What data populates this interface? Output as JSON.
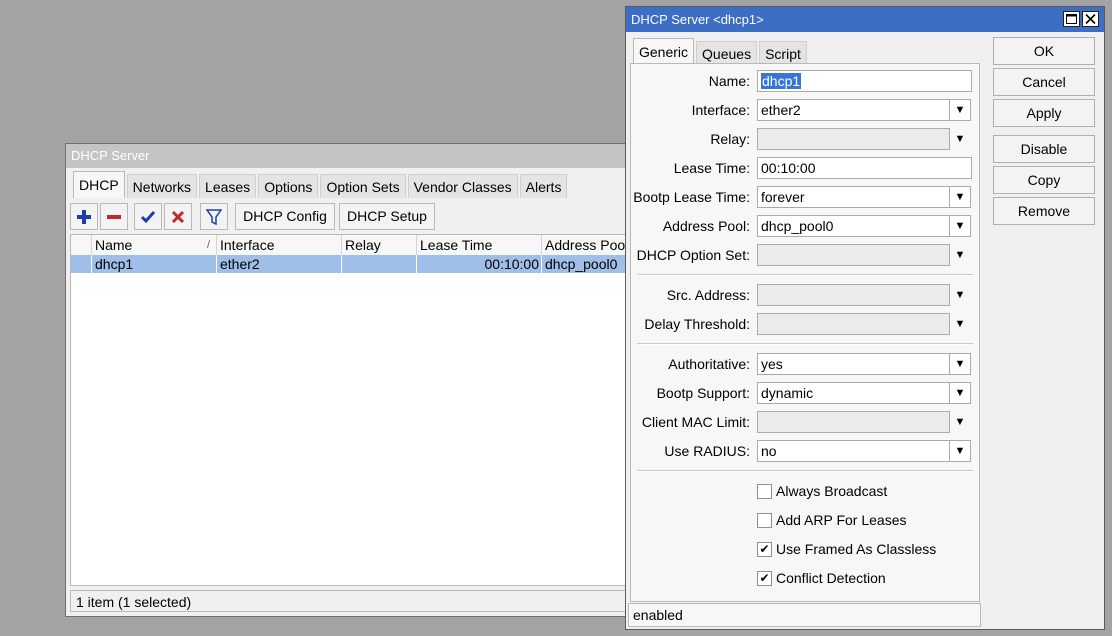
{
  "bg_window": {
    "title": "DHCP Server",
    "tabs": [
      "DHCP",
      "Networks",
      "Leases",
      "Options",
      "Option Sets",
      "Vendor Classes",
      "Alerts"
    ],
    "toolbar": {
      "add_icon": "plus-icon",
      "remove_icon": "minus-icon",
      "enable_icon": "check-icon",
      "disable_icon": "x-icon",
      "filter_icon": "filter-icon",
      "dhcp_config": "DHCP Config",
      "dhcp_setup": "DHCP Setup"
    },
    "columns": [
      "Name",
      "Interface",
      "Relay",
      "Lease Time",
      "Address Pool"
    ],
    "sort_indicator": "/",
    "rows": [
      {
        "name": "dhcp1",
        "interface": "ether2",
        "relay": "",
        "lease_time": "00:10:00",
        "address_pool": "dhcp_pool0"
      }
    ],
    "status": "1 item (1 selected)"
  },
  "dialog": {
    "title": "DHCP Server <dhcp1>",
    "tabs": [
      "Generic",
      "Queues",
      "Script"
    ],
    "fields": {
      "name": {
        "label": "Name:",
        "value": "dhcp1"
      },
      "interface": {
        "label": "Interface:",
        "value": "ether2"
      },
      "relay": {
        "label": "Relay:",
        "value": ""
      },
      "lease_time": {
        "label": "Lease Time:",
        "value": "00:10:00"
      },
      "bootp_lease_time": {
        "label": "Bootp Lease Time:",
        "value": "forever"
      },
      "address_pool": {
        "label": "Address Pool:",
        "value": "dhcp_pool0"
      },
      "dhcp_option_set": {
        "label": "DHCP Option Set:",
        "value": ""
      },
      "src_address": {
        "label": "Src. Address:",
        "value": ""
      },
      "delay_threshold": {
        "label": "Delay Threshold:",
        "value": ""
      },
      "authoritative": {
        "label": "Authoritative:",
        "value": "yes"
      },
      "bootp_support": {
        "label": "Bootp Support:",
        "value": "dynamic"
      },
      "client_mac_limit": {
        "label": "Client MAC Limit:",
        "value": ""
      },
      "use_radius": {
        "label": "Use RADIUS:",
        "value": "no"
      }
    },
    "checkboxes": [
      {
        "label": "Always Broadcast",
        "checked": false
      },
      {
        "label": "Add ARP For Leases",
        "checked": false
      },
      {
        "label": "Use Framed As Classless",
        "checked": true
      },
      {
        "label": "Conflict Detection",
        "checked": true
      }
    ],
    "buttons": {
      "ok": "OK",
      "cancel": "Cancel",
      "apply": "Apply",
      "disable": "Disable",
      "copy": "Copy",
      "remove": "Remove"
    },
    "status": "enabled",
    "check_mark": "✔"
  }
}
